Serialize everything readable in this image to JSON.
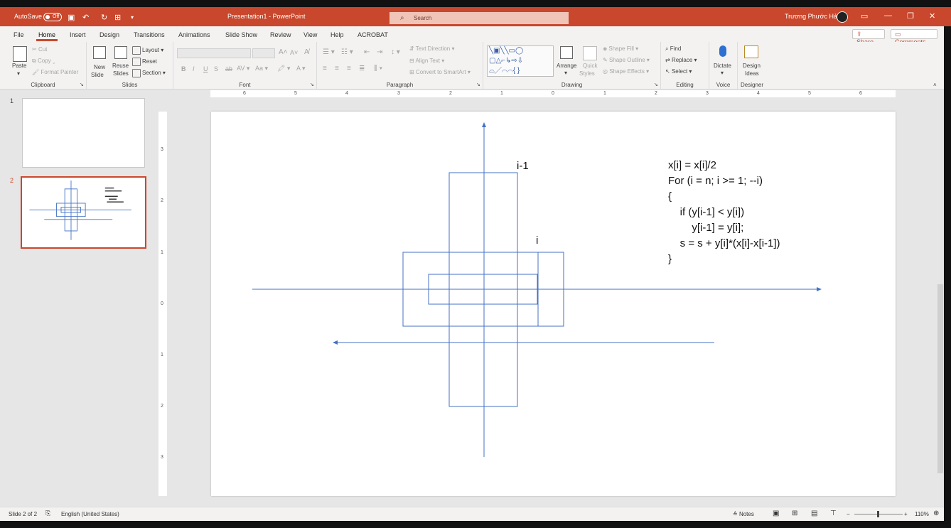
{
  "titlebar": {
    "autosave_label": "AutoSave",
    "autosave_state": "Off",
    "document_title": "Presentation1 - PowerPoint",
    "search_placeholder": "Search",
    "user_name": "Trương Phước Hải"
  },
  "menu": {
    "tabs": [
      "File",
      "Home",
      "Insert",
      "Design",
      "Transitions",
      "Animations",
      "Slide Show",
      "Review",
      "View",
      "Help",
      "ACROBAT"
    ],
    "share_label": "Share",
    "comments_label": "Comments"
  },
  "ribbon": {
    "clipboard": {
      "paste": "Paste",
      "cut": "Cut",
      "copy": "Copy",
      "format_painter": "Format Painter",
      "label": "Clipboard"
    },
    "slides": {
      "new_slide_1": "New",
      "new_slide_2": "Slide",
      "reuse_1": "Reuse",
      "reuse_2": "Slides",
      "layout": "Layout",
      "reset": "Reset",
      "section": "Section",
      "label": "Slides"
    },
    "font": {
      "label": "Font"
    },
    "paragraph": {
      "text_direction": "Text Direction",
      "align_text": "Align Text",
      "convert_smartart": "Convert to SmartArt",
      "label": "Paragraph"
    },
    "drawing": {
      "arrange": "Arrange",
      "quick_styles_1": "Quick",
      "quick_styles_2": "Styles",
      "shape_fill": "Shape Fill",
      "shape_outline": "Shape Outline",
      "shape_effects": "Shape Effects",
      "label": "Drawing"
    },
    "editing": {
      "find": "Find",
      "replace": "Replace",
      "select": "Select",
      "label": "Editing"
    },
    "voice": {
      "dictate": "Dictate",
      "label": "Voice"
    },
    "designer": {
      "design_ideas_1": "Design",
      "design_ideas_2": "Ideas",
      "label": "Designer"
    }
  },
  "thumbnails": {
    "numbers": [
      "1",
      "2"
    ],
    "selected": "2"
  },
  "rulers": {
    "horizontal": [
      "6",
      "5",
      "4",
      "3",
      "2",
      "1",
      "0",
      "1",
      "2",
      "3",
      "4",
      "5",
      "6"
    ],
    "vertical": [
      "3",
      "2",
      "1",
      "0",
      "1",
      "2",
      "3"
    ]
  },
  "slide": {
    "label_i_minus_1": "i-1",
    "label_i": "i",
    "code_lines": [
      "x[i] = x[i]/2",
      "For (i = n; i >= 1; --i)",
      "{",
      "    if (y[i-1] < y[i])",
      "        y[i-1] = y[i];",
      "    s = s + y[i]*(x[i]-x[i-1])",
      "}"
    ],
    "shape_color": "#4472c4"
  },
  "statusbar": {
    "slide_info": "Slide 2 of 2",
    "language": "English (United States)",
    "notes": "Notes",
    "zoom": "110%"
  }
}
